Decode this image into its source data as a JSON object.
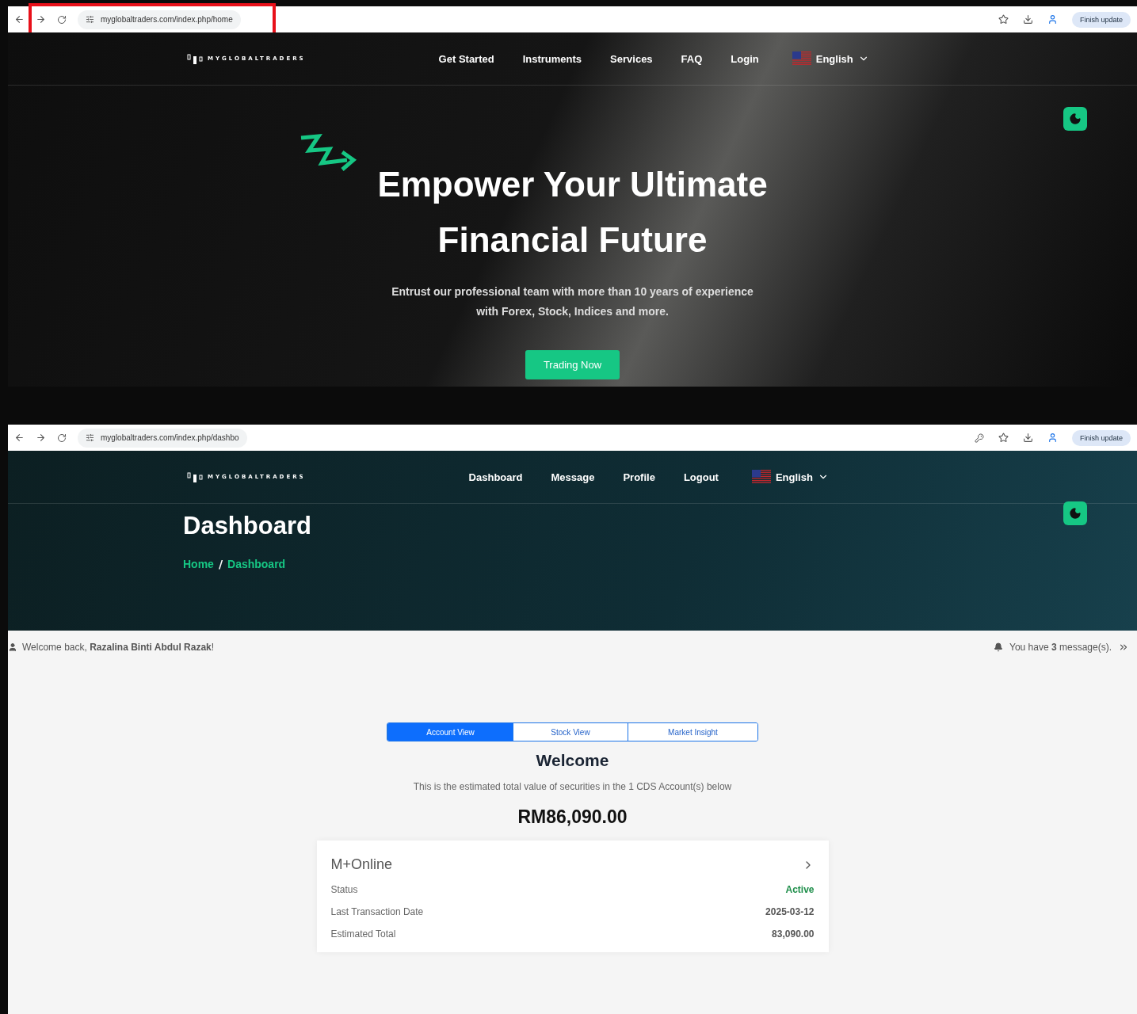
{
  "home_screen": {
    "browser": {
      "url": "myglobaltraders.com/index.php/home",
      "update_button": "Finish update"
    },
    "nav": {
      "logo": "MYGLOBALTRADERS",
      "items": [
        "Get Started",
        "Instruments",
        "Services",
        "FAQ",
        "Login"
      ],
      "language": "English"
    },
    "hero": {
      "title_lines": [
        "Empower Your Ultimate",
        "Financial Future"
      ],
      "subtitle_lines": [
        "Entrust our professional team with more than 10 years of experience",
        "with Forex, Stock, Indices and more."
      ],
      "button": "Trading Now"
    }
  },
  "dashboard_screen": {
    "browser": {
      "url": "myglobaltraders.com/index.php/dashbo",
      "update_button": "Finish update"
    },
    "nav": {
      "logo": "MYGLOBALTRADERS",
      "items": [
        "Dashboard",
        "Message",
        "Profile",
        "Logout"
      ],
      "language": "English"
    },
    "page_title": "Dashboard",
    "breadcrumb": [
      "Home",
      "Dashboard"
    ],
    "breadcrumb_separator": "/",
    "welcome": "Welcome back, **Razalina Binti Abdul Razak**!",
    "messages": "You have **3** message(s).",
    "tabs": [
      {
        "label": "Account View",
        "selected": true
      },
      {
        "label": "Stock View",
        "selected": false
      },
      {
        "label": "Market Insight",
        "selected": false
      }
    ],
    "heading": "Welcome",
    "description": "This is the estimated total value of securities in the 1 CDS Account(s) below",
    "total": "RM86,090.00",
    "card": {
      "title": "M+Online",
      "rows": [
        {
          "label": "Status",
          "value": "Active",
          "kind": "status"
        },
        {
          "label": "Last Transaction Date",
          "value": "2025-03-12",
          "kind": "plain"
        },
        {
          "label": "Estimated Total",
          "value": "83,090.00",
          "kind": "plain"
        }
      ]
    }
  }
}
